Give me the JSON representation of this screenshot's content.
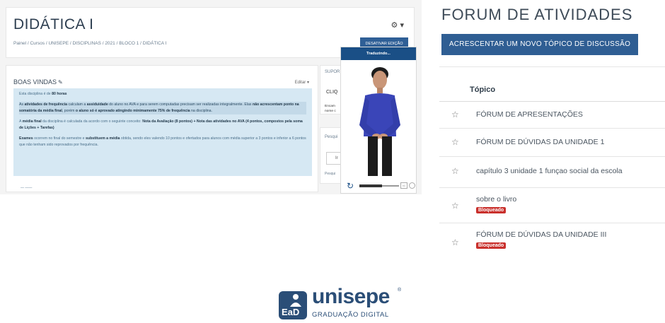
{
  "course": {
    "title": "DIDÁTICA I",
    "breadcrumb": "Painel / Cursos / UNISEPE / DISCIPLINAS / 2021 / BLOCO 1 / DIDÁTICA I",
    "toggle_edit_label": "DESATIVAR EDIÇÃO"
  },
  "welcome_block": {
    "title": "BOAS VINDAS",
    "edit_label": "Editar",
    "intro_prefix": "Esta disciplina é de ",
    "intro_hours": "80 horas",
    "p1_a": "As ",
    "p1_b": "atividades de frequência",
    "p1_c": " calculam a ",
    "p1_d": "assiduidade",
    "p1_e": " do aluno no AVA e para serem computadas precisam ser realizadas integralmente. Elas ",
    "p1_f": "não acrescentam ponto na somatória da média final",
    "p1_g": ", porém ",
    "p1_h": "o aluno só é aprovado atingindo minimamente 75% de frequência",
    "p1_i": " na disciplina.",
    "p2_a": "A ",
    "p2_b": "média final",
    "p2_c": " da disciplina é calculada da acordo com o seguinte conceito: ",
    "p2_d": "Nota da Avaliação (8 pontos) + Nota das atividades no AVA (4 pontos, compostos pela soma de Lições + Tarefas)",
    "p3_a": "Exames",
    "p3_b": " ocorrem no final do semestre e ",
    "p3_c": "substituem a média",
    "p3_d": " obtida, sendo eles valendo 10 pontos e ofertados para alunos com média superior a 3 pontos e inferior a 6 pontos que não tenham sido reprovados por frequência.",
    "footer": "— ——"
  },
  "side": {
    "support_label": "SUPOR",
    "click_label": "CLIQ",
    "enc_text": "Encam nome c",
    "search_label": "Pesqui",
    "search_value": "Ir",
    "search_label2": "Pesqui"
  },
  "vlibras": {
    "header": "Traduzindo...",
    "speed": "x1"
  },
  "forum": {
    "title": "FORUM DE ATIVIDADES",
    "add_button": "ACRESCENTAR UM NOVO TÓPICO DE DISCUSSÃO",
    "column_header": "Tópico",
    "rows": [
      {
        "name": "FÓRUM DE APRESENTAÇÕES",
        "badge": ""
      },
      {
        "name": "FÓRUM DE DÚVIDAS DA UNIDADE 1",
        "badge": ""
      },
      {
        "name": "capítulo 3 unidade 1 funçao social da escola",
        "badge": ""
      },
      {
        "name": "sobre o livro",
        "badge": "Bloqueado"
      },
      {
        "name": "FÓRUM DE DÚVIDAS DA UNIDADE III",
        "badge": "Bloqueado"
      }
    ]
  },
  "logo": {
    "brand": "unisepe",
    "mark_text": "EaD",
    "reg": "®",
    "subtitle": "GRADUAÇÃO DIGITAL"
  },
  "icons": {
    "gear": "gear-icon",
    "pencil": "pencil-icon",
    "star": "star-outline-icon",
    "replay": "replay-icon"
  },
  "colors": {
    "primary": "#2f5e93",
    "badge": "#c9302c",
    "info_bg": "#d6e8f3"
  }
}
